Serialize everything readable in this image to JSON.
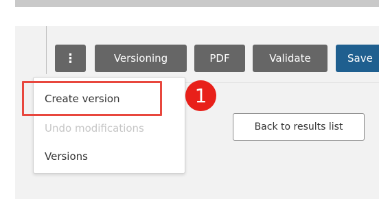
{
  "toolbar": {
    "more_icon": "⋮",
    "versioning_label": "Versioning",
    "pdf_label": "PDF",
    "validate_label": "Validate",
    "save_label": "Save"
  },
  "dropdown": {
    "items": [
      {
        "label": "Create version",
        "enabled": true
      },
      {
        "label": "Undo modifications",
        "enabled": false
      },
      {
        "label": "Versions",
        "enabled": true
      }
    ]
  },
  "back_button": {
    "label": "Back to results list"
  },
  "annotation": {
    "step": "1"
  },
  "colors": {
    "toolbar_button": "#666666",
    "save_button": "#1f5f8f",
    "highlight": "#e8473e",
    "badge": "#e8201a",
    "disabled_text": "#c6c6c6"
  }
}
